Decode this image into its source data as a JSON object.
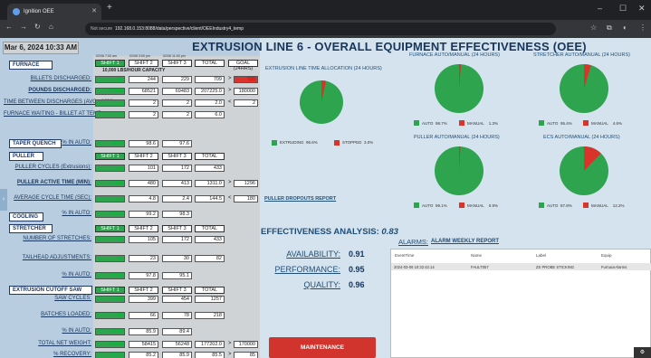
{
  "browser": {
    "tab_title": "Ignition OEE",
    "url_warning": "Not secure",
    "url": "192.168.0.153:8088/data/perspective/client/OEEIndustry4_temp"
  },
  "header": {
    "date": "Mar 6, 2024 10:33 AM",
    "title": "EXTRUSION LINE 6 - OVERALL EQUIPMENT EFFECTIVENESS (OEE)",
    "shift_times": [
      "02/06 7:00 am",
      "02/06 3:00 pm",
      "02/06 11:00 pm"
    ]
  },
  "col_headers": {
    "s1": "SHIFT 1",
    "s2": "SHIFT 2",
    "s3": "SHIFT 3",
    "total": "TOTAL",
    "goal": "GOAL (24HRS)"
  },
  "furnace": {
    "title": "FURNACE",
    "capacity": "10,000 LBS/HOUR CAPACITY",
    "rows": [
      {
        "label": "BILLETS DISCHARGED:",
        "s1": "35",
        "s2": "244",
        "s3": "229",
        "total": "709",
        "op": ">",
        "goal": "720"
      },
      {
        "label": "POUNDS DISCHARGED:",
        "s1": "75318",
        "s2": "68521",
        "s3": "69483",
        "total": "207225.0",
        "op": ">",
        "goal": "180000"
      },
      {
        "label": "TIME BETWEEN DISCHARGES (AVG - MIN):",
        "s1": "2",
        "s2": "2",
        "s3": "2",
        "total": "2.0",
        "op": "<",
        "goal": "2"
      },
      {
        "label": "FURNACE WAITING - BILLET AT TEMP:",
        "s1": "2",
        "s2": "2",
        "s3": "2",
        "total": "6.0",
        "op": "",
        "goal": ""
      }
    ]
  },
  "taper": {
    "title": "TAPER QUENCH",
    "auto_label": "% IN AUTO:",
    "s1": "99.6",
    "s2": "98.6",
    "s3": "97.6"
  },
  "puller": {
    "title": "PULLER",
    "rows": [
      {
        "label": "PULLER CYCLES (Extrusions):",
        "s1": "160",
        "s2": "101",
        "s3": "172",
        "total": "433",
        "op": "",
        "goal": ""
      },
      {
        "label": "PULLER ACTIVE TIME (MIN):",
        "s1": "418",
        "s2": "480",
        "s3": "413",
        "total": "1311.0",
        "op": ">",
        "goal": "1296"
      },
      {
        "label": "AVERAGE CYCLE TIME (SEC):",
        "s1": "2.4",
        "s2": "4.8",
        "s3": "2.4",
        "total": "144.5",
        "op": "<",
        "goal": "180"
      },
      {
        "label": "% IN AUTO:",
        "s1": "99.5",
        "s2": "99.2",
        "s3": "98.3",
        "total": "",
        "op": "",
        "goal": ""
      }
    ]
  },
  "cooling": {
    "title": "COOLING"
  },
  "stretcher": {
    "title": "STRETCHER",
    "rows": [
      {
        "label": "NUMBER OF STRETCHES:",
        "s1": "156",
        "s2": "105",
        "s3": "172",
        "total": "433",
        "op": "",
        "goal": ""
      },
      {
        "label": "TAILHEAD ADJUSTMENTS:",
        "s1": "26",
        "s2": "23",
        "s3": "30",
        "total": "82",
        "op": "",
        "goal": ""
      },
      {
        "label": "% IN AUTO:",
        "s1": "97.8",
        "s2": "97.8",
        "s3": "95.1",
        "total": "",
        "op": "",
        "goal": ""
      }
    ]
  },
  "saw": {
    "title": "EXTRUSION CUTOFF SAW",
    "rows": [
      {
        "label": "SAW CYCLES:",
        "s1": "404",
        "s2": "399",
        "s3": "454",
        "total": "1257",
        "op": "",
        "goal": ""
      },
      {
        "label": "BATCHES LOADED:",
        "s1": "24",
        "s2": "66",
        "s3": "78",
        "total": "218",
        "op": "",
        "goal": ""
      },
      {
        "label": "% IN AUTO:",
        "s1": "86.6",
        "s2": "85.9",
        "s3": "89.4",
        "total": "",
        "op": "",
        "goal": ""
      }
    ]
  },
  "totals": {
    "rows": [
      {
        "label": "TOTAL NET WEIGHT:",
        "s1": "58815",
        "s2": "58415",
        "s3": "56248",
        "total": "177202.0",
        "op": ">",
        "goal": "170000"
      },
      {
        "label": "% RECOVERY:",
        "s1": "85.2",
        "s2": "85.2",
        "s3": "85.9",
        "total": "85.5",
        "op": ">",
        "goal": "85"
      }
    ]
  },
  "allocation": {
    "title": "EXTRUSION LINE TIME ALLOCATION (24 HOURS)",
    "legend": [
      {
        "label": "EXTRUDING",
        "value": "96.6%",
        "pct": 96.6,
        "color": "#2ea44f"
      },
      {
        "label": "STOPPED",
        "value": "3.0%",
        "pct": 3.0,
        "color": "#d9342b"
      }
    ]
  },
  "furnace_am": {
    "title": "FURNACE AUTO/MANUAL (24 HOURS)",
    "auto_label": "AUTO",
    "auto_value": "98.7%",
    "auto_pct": 98.7,
    "manual_label": "MANUAL",
    "manual_value": "1.3%"
  },
  "stretcher_am": {
    "title": "STRETCHER AUTO/MANUAL (24 HOURS)",
    "auto_label": "AUTO",
    "auto_value": "95.4%",
    "auto_pct": 95.4,
    "manual_label": "MANUAL",
    "manual_value": "4.6%"
  },
  "puller_am": {
    "title": "PULLER AUTO/MANUAL (24 HOURS)",
    "auto_label": "AUTO",
    "auto_value": "99.1%",
    "auto_pct": 99.1,
    "manual_label": "MANUAL",
    "manual_value": "0.9%"
  },
  "ecs_am": {
    "title": "ECS AUTO/MANUAL (24 HOURS)",
    "auto_label": "AUTO",
    "auto_value": "87.8%",
    "auto_pct": 87.8,
    "manual_label": "MANUAL",
    "manual_value": "12.2%"
  },
  "links": {
    "puller_dropouts": "PULLER DROPOUTS REPORT",
    "alarm_weekly": "ALARM WEEKLY REPORT"
  },
  "effectiveness": {
    "title": "EFFECTIVENESS ANALYSIS:",
    "value": "0.83",
    "metrics": [
      {
        "label": "AVAILABILITY:",
        "value": "0.91"
      },
      {
        "label": "PERFORMANCE:",
        "value": "0.95"
      },
      {
        "label": "QUALITY:",
        "value": "0.96"
      }
    ]
  },
  "alarms": {
    "title": "ALARMS:",
    "columns": [
      "EventTime",
      "Name",
      "Label",
      "Equip"
    ],
    "rows": [
      {
        "time": "2024-03-06 10:32:43.14",
        "name": "FAULT057",
        "label": "ZS PROBE STICKING",
        "equip": "FurnaceAlarms"
      }
    ]
  },
  "maintenance": {
    "label": "MAINTENANCE"
  },
  "colors": {
    "green": "#2ea44f",
    "red": "#d9342b",
    "navy": "#1f3864"
  }
}
